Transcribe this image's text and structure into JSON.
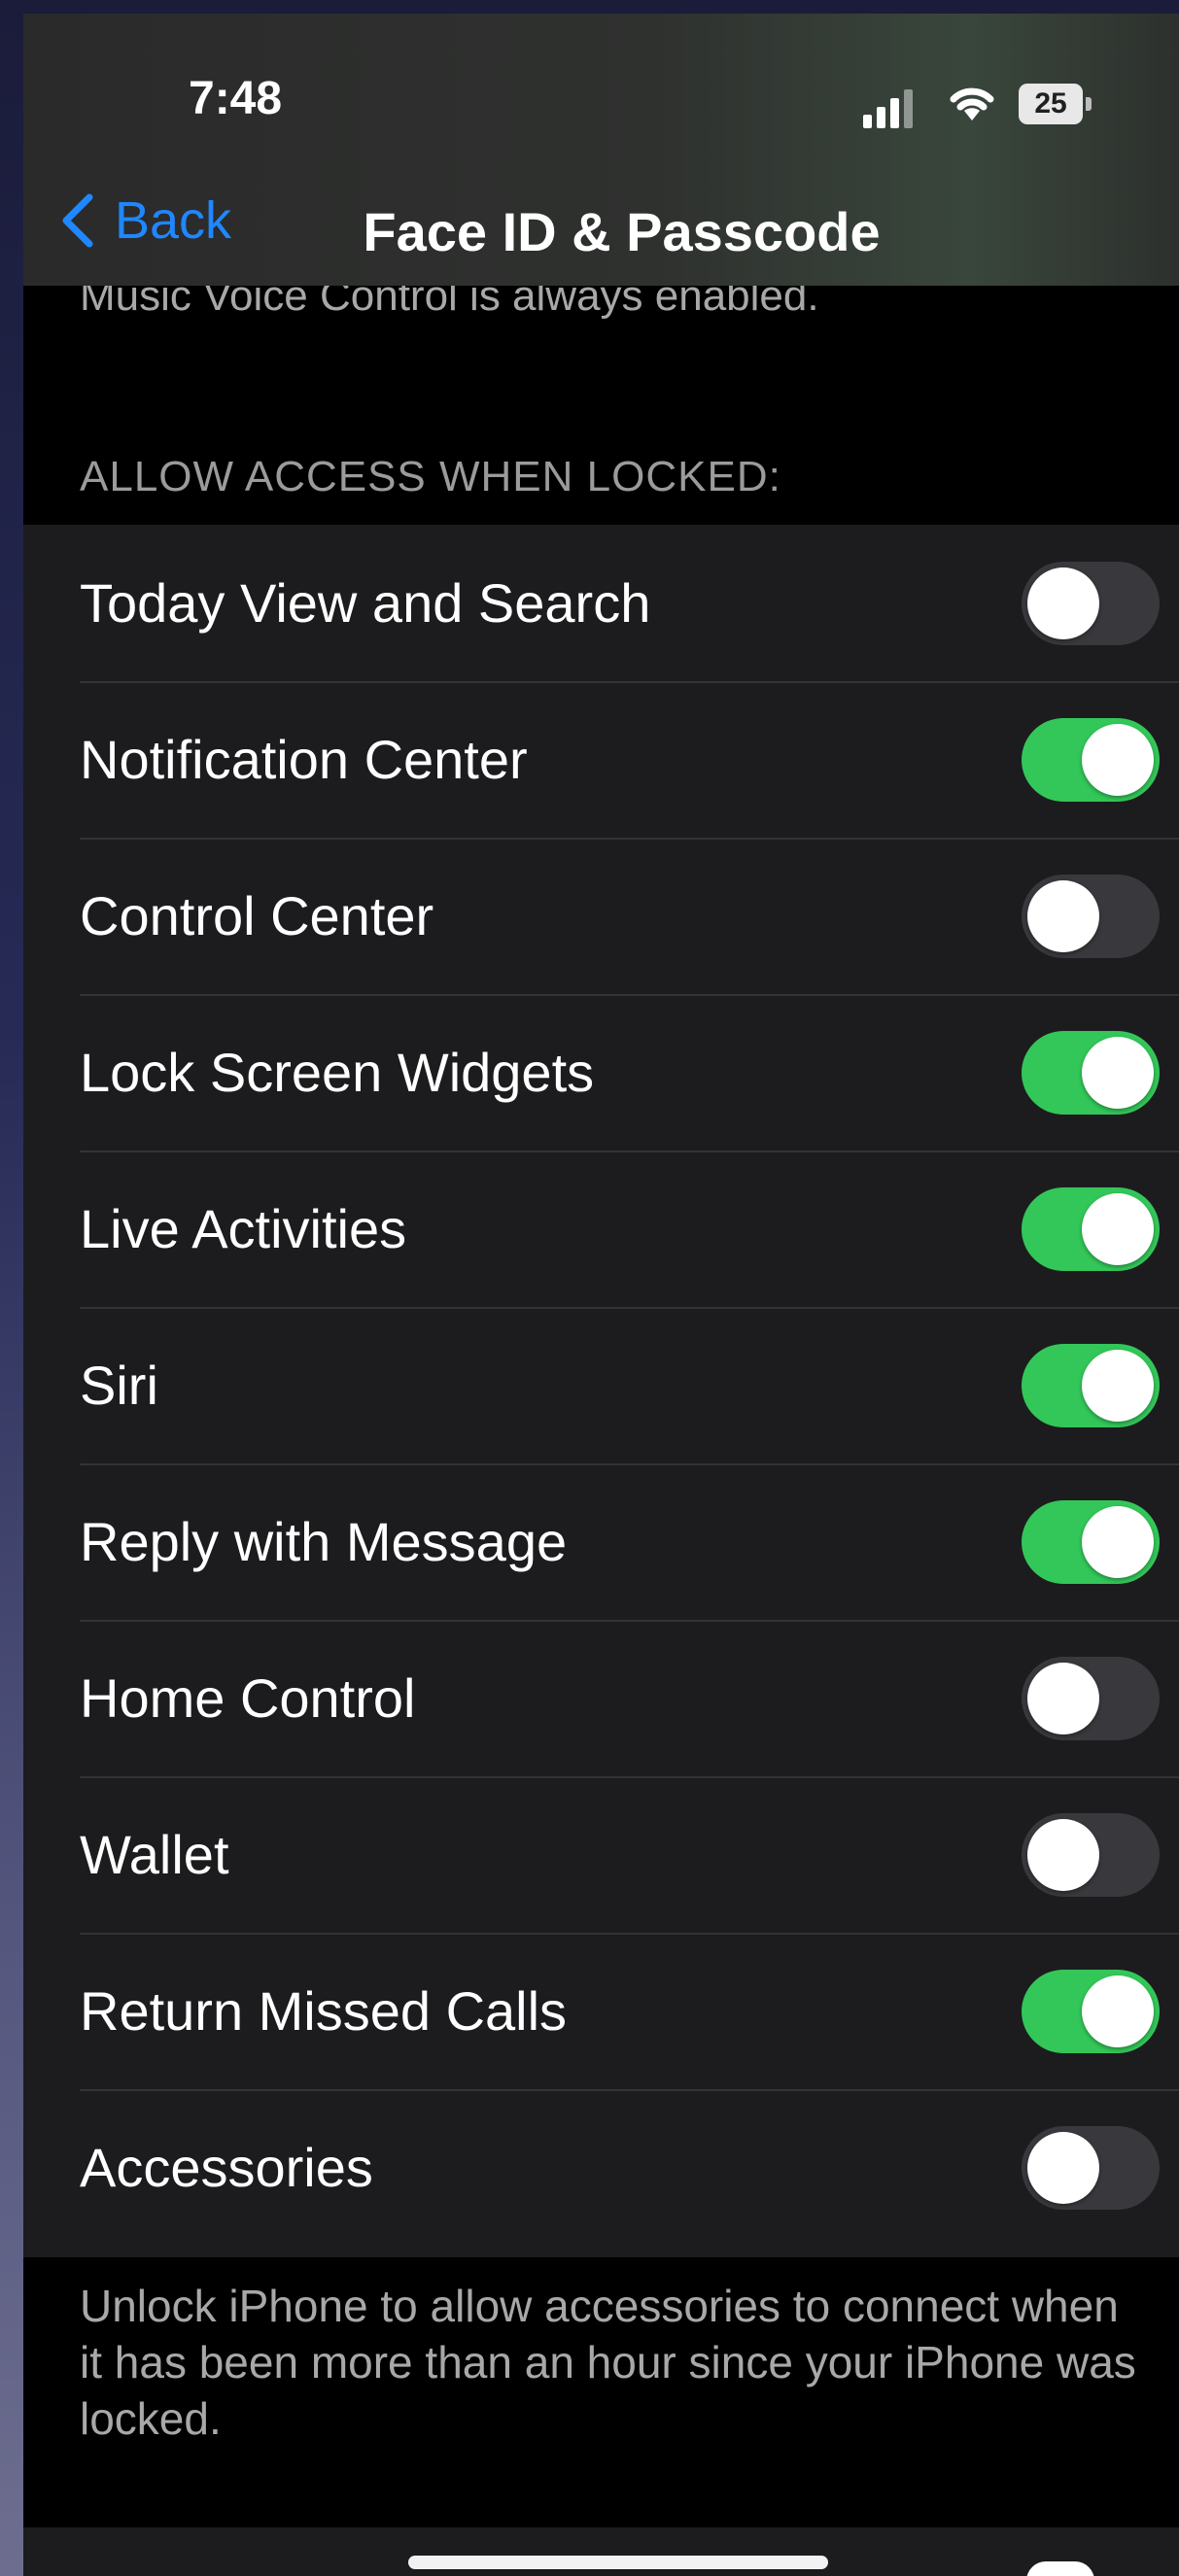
{
  "status_bar": {
    "time": "7:48",
    "battery": "25"
  },
  "nav": {
    "back_label": "Back",
    "title": "Face ID & Passcode"
  },
  "top_note": "Music Voice Control is always enabled.",
  "section": {
    "header": "ALLOW ACCESS WHEN LOCKED:",
    "items": [
      {
        "label": "Today View and Search",
        "on": false
      },
      {
        "label": "Notification Center",
        "on": true
      },
      {
        "label": "Control Center",
        "on": false
      },
      {
        "label": "Lock Screen Widgets",
        "on": true
      },
      {
        "label": "Live Activities",
        "on": true
      },
      {
        "label": "Siri",
        "on": true
      },
      {
        "label": "Reply with Message",
        "on": true
      },
      {
        "label": "Home Control",
        "on": false
      },
      {
        "label": "Wallet",
        "on": false
      },
      {
        "label": "Return Missed Calls",
        "on": true
      },
      {
        "label": "Accessories",
        "on": false
      }
    ],
    "footer": "Unlock iPhone to allow accessories to connect when it has been more than an hour since your iPhone was locked."
  },
  "colors": {
    "accent": "#1f87ff",
    "toggle_on": "#33c759",
    "toggle_off": "#39393d",
    "cell_background": "#1c1c1e"
  },
  "icons": [
    "signal-icon",
    "wifi-icon",
    "battery-icon",
    "chevron-left-icon"
  ]
}
